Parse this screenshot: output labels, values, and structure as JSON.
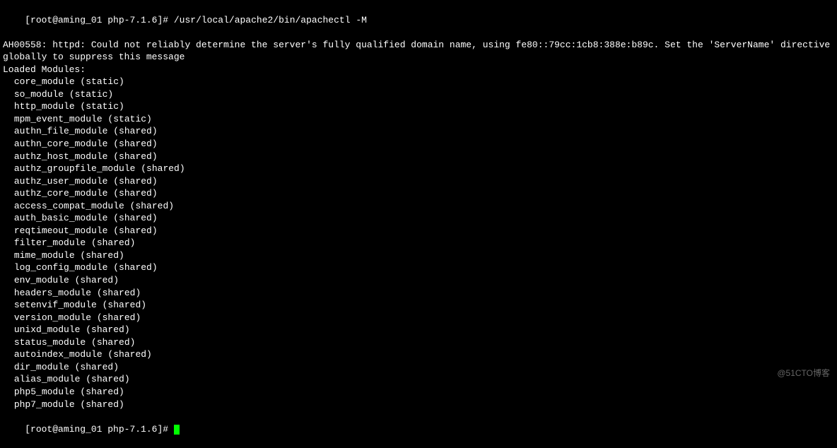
{
  "prompt1": {
    "user_host": "[root@aming_01 php-7.1.6]#",
    "command": "/usr/local/apache2/bin/apachectl -M"
  },
  "warning": "AH00558: httpd: Could not reliably determine the server's fully qualified domain name, using fe80::79cc:1cb8:388e:b89c. Set the 'ServerName' directive globally to suppress this message",
  "loaded_header": "Loaded Modules:",
  "modules": [
    "core_module (static)",
    "so_module (static)",
    "http_module (static)",
    "mpm_event_module (static)",
    "authn_file_module (shared)",
    "authn_core_module (shared)",
    "authz_host_module (shared)",
    "authz_groupfile_module (shared)",
    "authz_user_module (shared)",
    "authz_core_module (shared)",
    "access_compat_module (shared)",
    "auth_basic_module (shared)",
    "reqtimeout_module (shared)",
    "filter_module (shared)",
    "mime_module (shared)",
    "log_config_module (shared)",
    "env_module (shared)",
    "headers_module (shared)",
    "setenvif_module (shared)",
    "version_module (shared)",
    "unixd_module (shared)",
    "status_module (shared)",
    "autoindex_module (shared)",
    "dir_module (shared)",
    "alias_module (shared)",
    "php5_module (shared)",
    "php7_module (shared)"
  ],
  "prompt2": {
    "user_host": "[root@aming_01 php-7.1.6]#"
  },
  "watermark": "@51CTO博客"
}
